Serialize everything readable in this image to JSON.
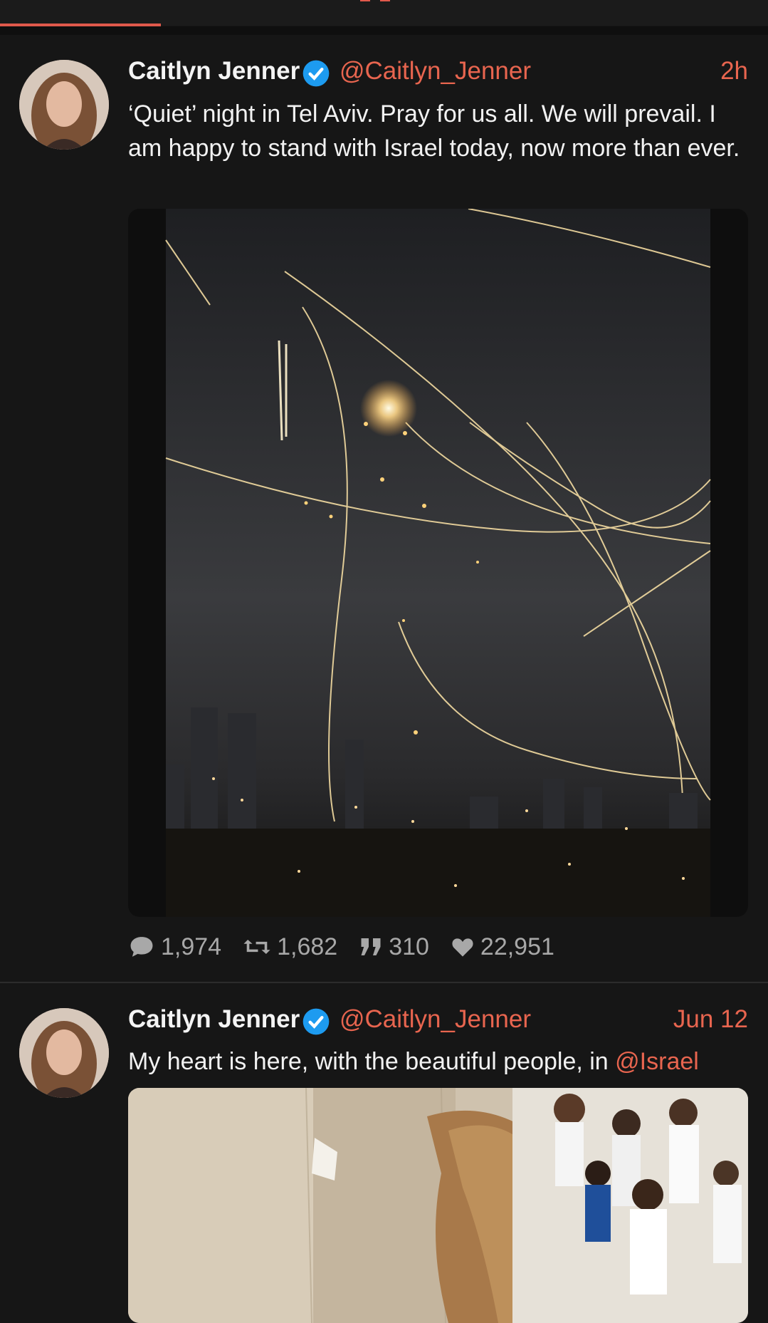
{
  "colors": {
    "accent": "#e8654f",
    "background": "#161616",
    "verified": "#1d9bf0"
  },
  "tweets": [
    {
      "name": "Caitlyn Jenner",
      "handle": "@Caitlyn_Jenner",
      "time": "2h",
      "text": "‘Quiet’ night in Tel Aviv. Pray for us all. We will prevail. I am happy to stand with Israel today, now more than ever.",
      "stats": {
        "replies": "1,974",
        "reposts": "1,682",
        "quotes": "310",
        "likes": "22,951"
      }
    },
    {
      "name": "Caitlyn Jenner",
      "handle": "@Caitlyn_Jenner",
      "time": "Jun 12",
      "text": "My heart is here, with the beautiful people, in ",
      "mention": "@Israel"
    }
  ],
  "icons": [
    "verified-icon",
    "reply-icon",
    "repost-icon",
    "quote-icon",
    "like-icon"
  ]
}
